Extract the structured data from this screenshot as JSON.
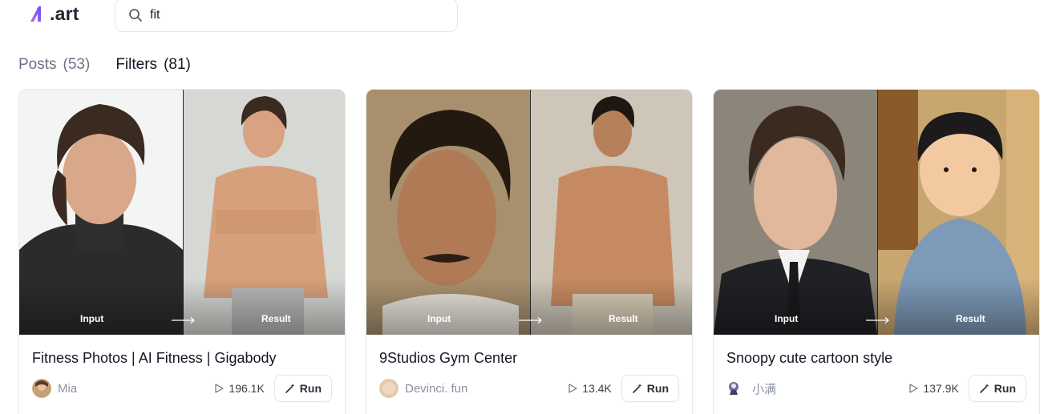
{
  "brand": {
    "logo_text": ".art",
    "accent": "#7b5cf5"
  },
  "search": {
    "value": "fit",
    "placeholder": ""
  },
  "tabs": [
    {
      "label": "Posts",
      "count": "(53)",
      "active": false
    },
    {
      "label": "Filters",
      "count": "(81)",
      "active": true
    }
  ],
  "cards": [
    {
      "input_label": "Input",
      "result_label": "Result",
      "title": "Fitness Photos | AI Fitness | Gigabody",
      "author": "Mia",
      "runs": "196.1K",
      "run_label": "Run",
      "input_bg": "#f1f2f2",
      "result_bg": "#cfd1cc"
    },
    {
      "input_label": "Input",
      "result_label": "Result",
      "title": "9Studios Gym Center",
      "author": "Devinci. fun",
      "runs": "13.4K",
      "run_label": "Run",
      "input_bg": "#a58e6c",
      "result_bg": "#c9c2b5"
    },
    {
      "input_label": "Input",
      "result_label": "Result",
      "title": "Snoopy cute cartoon style",
      "author": "小满",
      "runs": "137.9K",
      "run_label": "Run",
      "input_bg": "#8a8378",
      "result_bg": "#b8935f"
    }
  ],
  "icons": {
    "search": "search-icon",
    "play": "play-icon",
    "run": "magic-wand-icon",
    "arrow": "arrow-right-icon"
  }
}
